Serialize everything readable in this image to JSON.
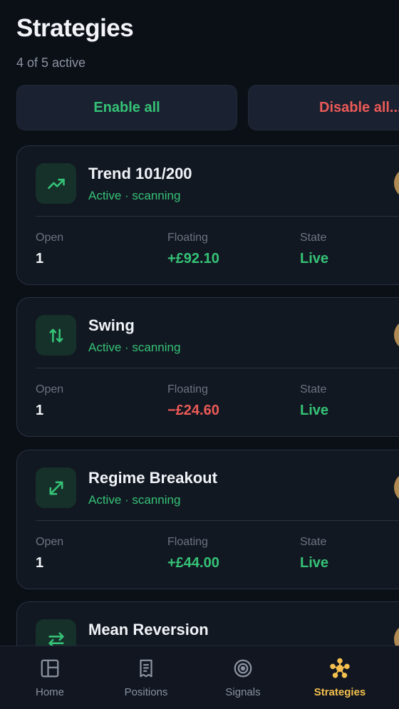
{
  "header": {
    "title": "Strategies",
    "subtitle": "4 of 5 active"
  },
  "actions": {
    "enable_label": "Enable all",
    "disable_label": "Disable all..."
  },
  "strategies": [
    {
      "name": "Trend 101/200",
      "status": "Active · scanning",
      "icon": "trending-up-icon",
      "open_label": "Open",
      "open_value": "1",
      "floating_label": "Floating",
      "floating_value": "+£92.10",
      "state_label": "State",
      "state_value": "Live"
    },
    {
      "name": "Swing",
      "status": "Active · scanning",
      "icon": "swap-vertical-icon",
      "open_label": "Open",
      "open_value": "1",
      "floating_label": "Floating",
      "floating_value": "−£24.60",
      "state_label": "State",
      "state_value": "Live"
    },
    {
      "name": "Regime Breakout",
      "status": "Active · scanning",
      "icon": "expand-diagonal-icon",
      "open_label": "Open",
      "open_value": "1",
      "floating_label": "Floating",
      "floating_value": "+£44.00",
      "state_label": "State",
      "state_value": "Live"
    },
    {
      "name": "Mean Reversion",
      "status": "",
      "icon": "swap-horizontal-icon"
    }
  ],
  "tabs": [
    {
      "label": "Home",
      "icon": "dashboard-icon",
      "active": false
    },
    {
      "label": "Positions",
      "icon": "receipt-icon",
      "active": false
    },
    {
      "label": "Signals",
      "icon": "radar-icon",
      "active": false
    },
    {
      "label": "Strategies",
      "icon": "hub-icon",
      "active": true
    }
  ],
  "colors": {
    "background": "#0b0f16",
    "card": "#121822",
    "positive": "#35c276",
    "negative": "#ec5a57",
    "accent": "#f5c04e"
  }
}
